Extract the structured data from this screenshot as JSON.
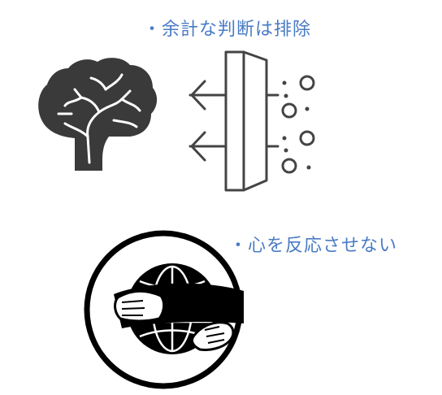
{
  "captions": {
    "exclude_judgment": "・余計な判断は排除",
    "no_react": "・心を反応させない"
  },
  "icons": {
    "brain": "brain-icon",
    "filter": "filter-icon",
    "globe_hug": "globe-hug-icon"
  },
  "colors": {
    "caption_text": "#4a7bc4",
    "brain_fill": "#3a3a3a",
    "filter_stroke": "#444444",
    "globe_stroke": "#000000"
  }
}
